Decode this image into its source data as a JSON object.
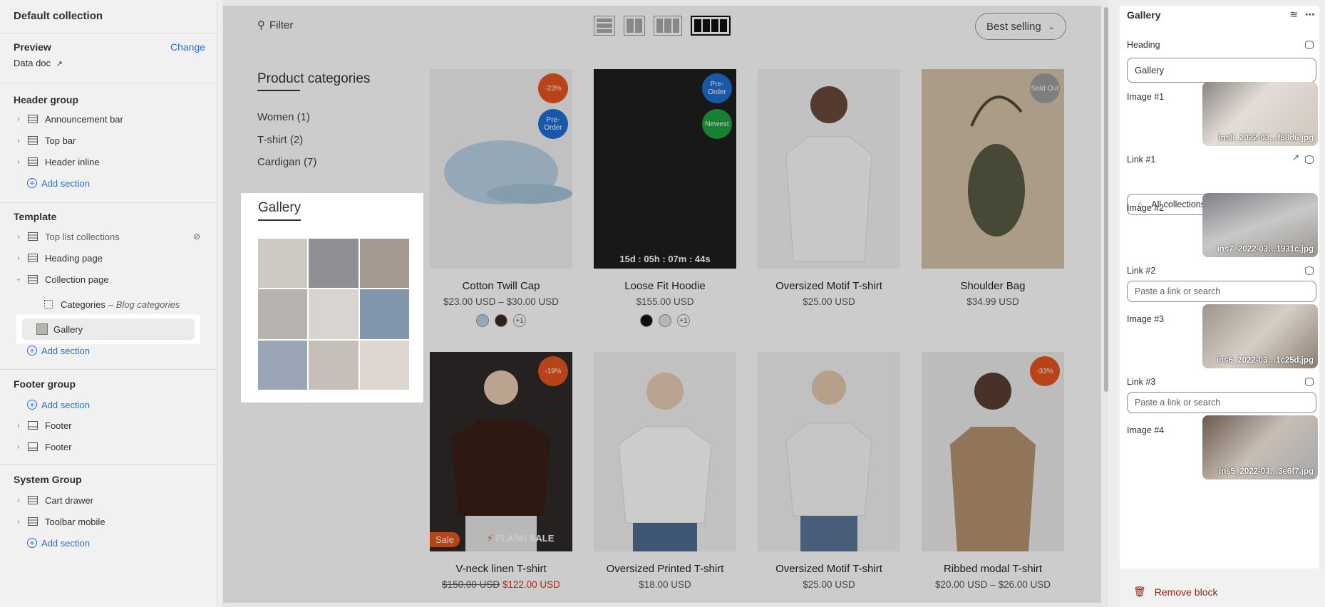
{
  "sidebar": {
    "title": "Default collection",
    "preview": {
      "label": "Preview",
      "change": "Change",
      "doc": "Data doc"
    },
    "header_group": {
      "label": "Header group",
      "items": [
        "Announcement bar",
        "Top bar",
        "Header inline"
      ],
      "add": "Add section"
    },
    "template": {
      "label": "Template",
      "items": [
        "Top list collections",
        "Heading page",
        "Collection page"
      ],
      "child_categories": "Categories",
      "child_categories_sub": "– Blog categories",
      "child_gallery": "Gallery",
      "add": "Add section"
    },
    "footer_group": {
      "label": "Footer group",
      "add": "Add section",
      "items": [
        "Footer",
        "Footer"
      ]
    },
    "system_group": {
      "label": "System Group",
      "items": [
        "Cart drawer",
        "Toolbar mobile"
      ],
      "add": "Add section"
    }
  },
  "store": {
    "filter": "Filter",
    "sort": "Best selling",
    "categories_title": "Product categories",
    "categories": [
      "Women (1)",
      "T-shirt (2)",
      "Cardigan (7)"
    ],
    "gallery_title": "Gallery",
    "products": [
      {
        "name": "Cotton Twill Cap",
        "price": "$23.00 USD – $30.00 USD",
        "badges": [
          "-23%",
          "Pre-Order"
        ],
        "more": "+1"
      },
      {
        "name": "Loose Fit Hoodie",
        "price": "$155.00 USD",
        "badges": [
          "Pre-Order",
          "Newest"
        ],
        "countdown": "15d : 05h : 07m : 44s",
        "more": "+1"
      },
      {
        "name": "Oversized Motif T-shirt",
        "price": "$25.00 USD"
      },
      {
        "name": "Shoulder Bag",
        "price": "$34.99 USD",
        "badges": [
          "Sold Out"
        ]
      },
      {
        "name": "V-neck linen T-shirt",
        "old_price": "$150.00 USD",
        "new_price": "$122.00 USD",
        "badges": [
          "-19%"
        ],
        "sale": "Sale",
        "flash": "FLASH SALE"
      },
      {
        "name": "Oversized Printed T-shirt",
        "price": "$18.00 USD"
      },
      {
        "name": "Oversized Motif T-shirt",
        "price": "$25.00 USD"
      },
      {
        "name": "Ribbed modal T-shirt",
        "price": "$20.00 USD – $26.00 USD",
        "badges": [
          "-33%"
        ]
      }
    ]
  },
  "panel": {
    "title": "Gallery",
    "heading_label": "Heading",
    "heading_value": "Gallery",
    "image1_label": "Image #1",
    "image1_file": "ins8_2022-03…f88d6.jpg",
    "link1_label": "Link #1",
    "link1_value": "All collections",
    "image2_label": "Image #2",
    "image2_file": "ins7_2022-03…1931c.jpg",
    "link2_label": "Link #2",
    "link2_placeholder": "Paste a link or search",
    "image3_label": "Image #3",
    "image3_file": "ins6_2022-03…1c25d.jpg",
    "link3_label": "Link #3",
    "link3_placeholder": "Paste a link or search",
    "image4_label": "Image #4",
    "image4_file": "ins5_2022-03…3e6f7.jpg",
    "remove": "Remove block"
  },
  "colors": {
    "accent": "#2c6ecb",
    "danger": "#8e1f0b",
    "badge_orange": "#e8541f",
    "badge_blue": "#1f6fd4",
    "badge_green": "#1ea03e"
  }
}
